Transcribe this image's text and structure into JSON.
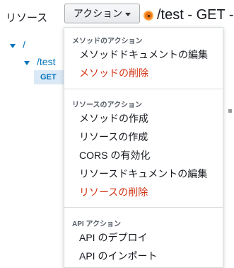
{
  "header": {
    "title": "リソース",
    "actions_button": "アクション",
    "resource_title": "/test - GET -"
  },
  "tree": {
    "root": "/",
    "child": "/test",
    "method": "GET"
  },
  "menu": {
    "sections": [
      {
        "header": "メソッドのアクション",
        "items": [
          {
            "label": "メソッドドキュメントの編集",
            "danger": false
          },
          {
            "label": "メソッドの削除",
            "danger": true
          }
        ]
      },
      {
        "header": "リソースのアクション",
        "items": [
          {
            "label": "メソッドの作成",
            "danger": false
          },
          {
            "label": "リソースの作成",
            "danger": false
          },
          {
            "label": "CORS の有効化",
            "danger": false
          },
          {
            "label": "リソースドキュメントの編集",
            "danger": false
          },
          {
            "label": "リソースの削除",
            "danger": true
          }
        ]
      },
      {
        "header": "API アクション",
        "items": [
          {
            "label": "API のデプロイ",
            "danger": false
          },
          {
            "label": "API のインポート",
            "danger": false
          }
        ]
      }
    ]
  },
  "colors": {
    "link": "#0073bb",
    "danger": "#d13212",
    "status": "#ec7211"
  }
}
